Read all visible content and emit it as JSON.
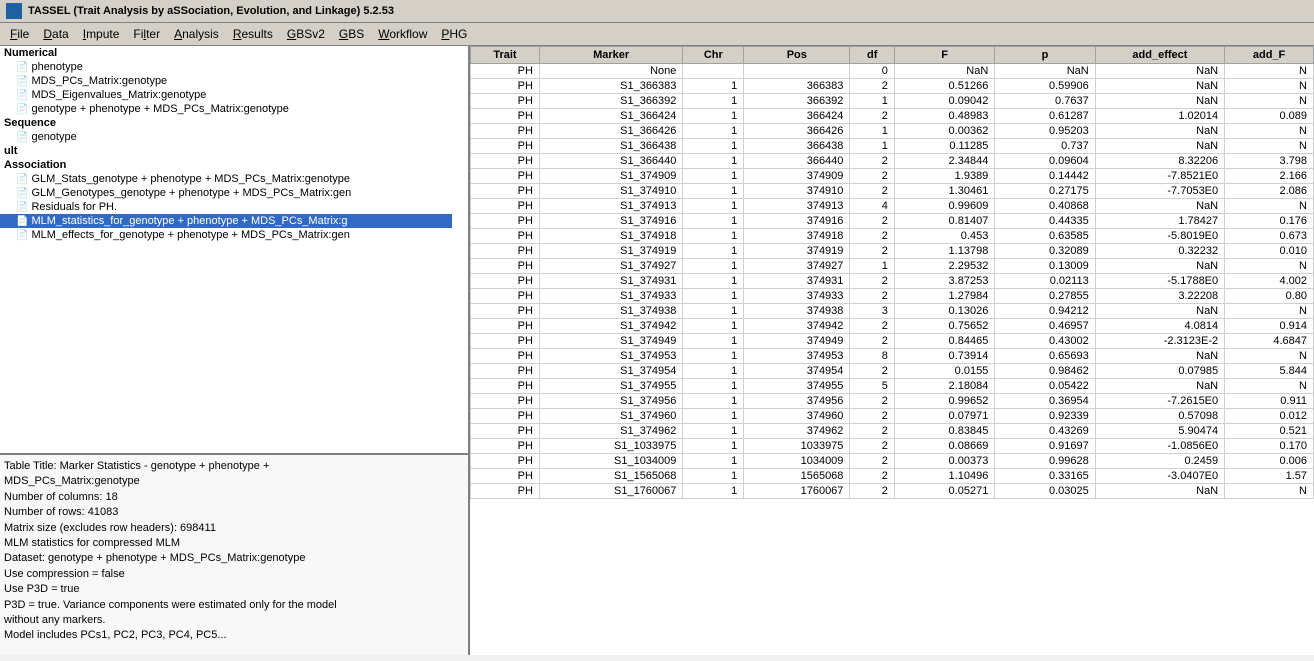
{
  "titleBar": {
    "icon": "tassel-icon",
    "title": "TASSEL (Trait Analysis by aSSociation, Evolution, and Linkage) 5.2.53"
  },
  "menuBar": {
    "items": [
      {
        "label": "File",
        "underline": "F"
      },
      {
        "label": "Data",
        "underline": "D"
      },
      {
        "label": "Impute",
        "underline": "I"
      },
      {
        "label": "Filter",
        "underline": "l"
      },
      {
        "label": "Analysis",
        "underline": "A"
      },
      {
        "label": "Results",
        "underline": "R"
      },
      {
        "label": "GBSv2",
        "underline": "G"
      },
      {
        "label": "GBS",
        "underline": "G"
      },
      {
        "label": "Workflow",
        "underline": "W"
      },
      {
        "label": "PHG",
        "underline": "P"
      }
    ]
  },
  "leftPanel": {
    "treeItems": [
      {
        "type": "header",
        "label": "Numerical"
      },
      {
        "type": "item",
        "label": "phenotype"
      },
      {
        "type": "item",
        "label": "MDS_PCs_Matrix:genotype"
      },
      {
        "type": "item",
        "label": "MDS_Eigenvalues_Matrix:genotype"
      },
      {
        "type": "item",
        "label": "genotype + phenotype + MDS_PCs_Matrix:genotype"
      },
      {
        "type": "header",
        "label": "Sequence"
      },
      {
        "type": "item",
        "label": "genotype"
      },
      {
        "type": "header",
        "label": "ult"
      },
      {
        "type": "header",
        "label": "Association"
      },
      {
        "type": "item",
        "label": "GLM_Stats_genotype + phenotype + MDS_PCs_Matrix:genotype"
      },
      {
        "type": "item",
        "label": "GLM_Genotypes_genotype + phenotype + MDS_PCs_Matrix:gen"
      },
      {
        "type": "item",
        "label": "Residuals for PH."
      },
      {
        "type": "item",
        "label": "MLM_statistics_for_genotype + phenotype + MDS_PCs_Matrix:g",
        "selected": true
      },
      {
        "type": "item",
        "label": "MLM_effects_for_genotype + phenotype + MDS_PCs_Matrix:gen"
      }
    ],
    "infoText": [
      "Table Title: Marker Statistics - genotype + phenotype +",
      "MDS_PCs_Matrix:genotype",
      "Number of columns: 18",
      "Number of rows: 41083",
      "Matrix size (excludes row headers): 698411",
      "MLM statistics for compressed MLM",
      "Dataset: genotype + phenotype + MDS_PCs_Matrix:genotype",
      "Use compression = false",
      "Use P3D = true",
      "P3D = true. Variance components were estimated only for the model",
      "without any markers.",
      "Model includes PCs1, PC2, PC3, PC4, PC5..."
    ]
  },
  "table": {
    "headers": [
      "Trait",
      "Marker",
      "Chr",
      "Pos",
      "df",
      "F",
      "p",
      "add_effect",
      "add_F"
    ],
    "rows": [
      [
        "PH",
        "None",
        "",
        "",
        "0",
        "NaN",
        "NaN",
        "NaN",
        "N"
      ],
      [
        "PH",
        "S1_366383",
        "1",
        "366383",
        "2",
        "0.51266",
        "0.59906",
        "NaN",
        "N"
      ],
      [
        "PH",
        "S1_366392",
        "1",
        "366392",
        "1",
        "0.09042",
        "0.7637",
        "NaN",
        "N"
      ],
      [
        "PH",
        "S1_366424",
        "1",
        "366424",
        "2",
        "0.48983",
        "0.61287",
        "1.02014",
        "0.089"
      ],
      [
        "PH",
        "S1_366426",
        "1",
        "366426",
        "1",
        "0.00362",
        "0.95203",
        "NaN",
        "N"
      ],
      [
        "PH",
        "S1_366438",
        "1",
        "366438",
        "1",
        "0.11285",
        "0.737",
        "NaN",
        "N"
      ],
      [
        "PH",
        "S1_366440",
        "1",
        "366440",
        "2",
        "2.34844",
        "0.09604",
        "8.32206",
        "3.798"
      ],
      [
        "PH",
        "S1_374909",
        "1",
        "374909",
        "2",
        "1.9389",
        "0.14442",
        "-7.8521E0",
        "2.166"
      ],
      [
        "PH",
        "S1_374910",
        "1",
        "374910",
        "2",
        "1.30461",
        "0.27175",
        "-7.7053E0",
        "2.086"
      ],
      [
        "PH",
        "S1_374913",
        "1",
        "374913",
        "4",
        "0.99609",
        "0.40868",
        "NaN",
        "N"
      ],
      [
        "PH",
        "S1_374916",
        "1",
        "374916",
        "2",
        "0.81407",
        "0.44335",
        "1.78427",
        "0.176"
      ],
      [
        "PH",
        "S1_374918",
        "1",
        "374918",
        "2",
        "0.453",
        "0.63585",
        "-5.8019E0",
        "0.673"
      ],
      [
        "PH",
        "S1_374919",
        "1",
        "374919",
        "2",
        "1.13798",
        "0.32089",
        "0.32232",
        "0.010"
      ],
      [
        "PH",
        "S1_374927",
        "1",
        "374927",
        "1",
        "2.29532",
        "0.13009",
        "NaN",
        "N"
      ],
      [
        "PH",
        "S1_374931",
        "1",
        "374931",
        "2",
        "3.87253",
        "0.02113",
        "-5.1788E0",
        "4.002"
      ],
      [
        "PH",
        "S1_374933",
        "1",
        "374933",
        "2",
        "1.27984",
        "0.27855",
        "3.22208",
        "0.80"
      ],
      [
        "PH",
        "S1_374938",
        "1",
        "374938",
        "3",
        "0.13026",
        "0.94212",
        "NaN",
        "N"
      ],
      [
        "PH",
        "S1_374942",
        "1",
        "374942",
        "2",
        "0.75652",
        "0.46957",
        "4.0814",
        "0.914"
      ],
      [
        "PH",
        "S1_374949",
        "1",
        "374949",
        "2",
        "0.84465",
        "0.43002",
        "-2.3123E-2",
        "4.6847"
      ],
      [
        "PH",
        "S1_374953",
        "1",
        "374953",
        "8",
        "0.73914",
        "0.65693",
        "NaN",
        "N"
      ],
      [
        "PH",
        "S1_374954",
        "1",
        "374954",
        "2",
        "0.0155",
        "0.98462",
        "0.07985",
        "5.844"
      ],
      [
        "PH",
        "S1_374955",
        "1",
        "374955",
        "5",
        "2.18084",
        "0.05422",
        "NaN",
        "N"
      ],
      [
        "PH",
        "S1_374956",
        "1",
        "374956",
        "2",
        "0.99652",
        "0.36954",
        "-7.2615E0",
        "0.911"
      ],
      [
        "PH",
        "S1_374960",
        "1",
        "374960",
        "2",
        "0.07971",
        "0.92339",
        "0.57098",
        "0.012"
      ],
      [
        "PH",
        "S1_374962",
        "1",
        "374962",
        "2",
        "0.83845",
        "0.43269",
        "5.90474",
        "0.521"
      ],
      [
        "PH",
        "S1_1033975",
        "1",
        "1033975",
        "2",
        "0.08669",
        "0.91697",
        "-1.0856E0",
        "0.170"
      ],
      [
        "PH",
        "S1_1034009",
        "1",
        "1034009",
        "2",
        "0.00373",
        "0.99628",
        "0.2459",
        "0.006"
      ],
      [
        "PH",
        "S1_1565068",
        "1",
        "1565068",
        "2",
        "1.10496",
        "0.33165",
        "-3.0407E0",
        "1.57"
      ],
      [
        "PH",
        "S1_1760067",
        "1",
        "1760067",
        "2",
        "0.05271",
        "0.03025",
        "NaN",
        "N"
      ]
    ]
  }
}
